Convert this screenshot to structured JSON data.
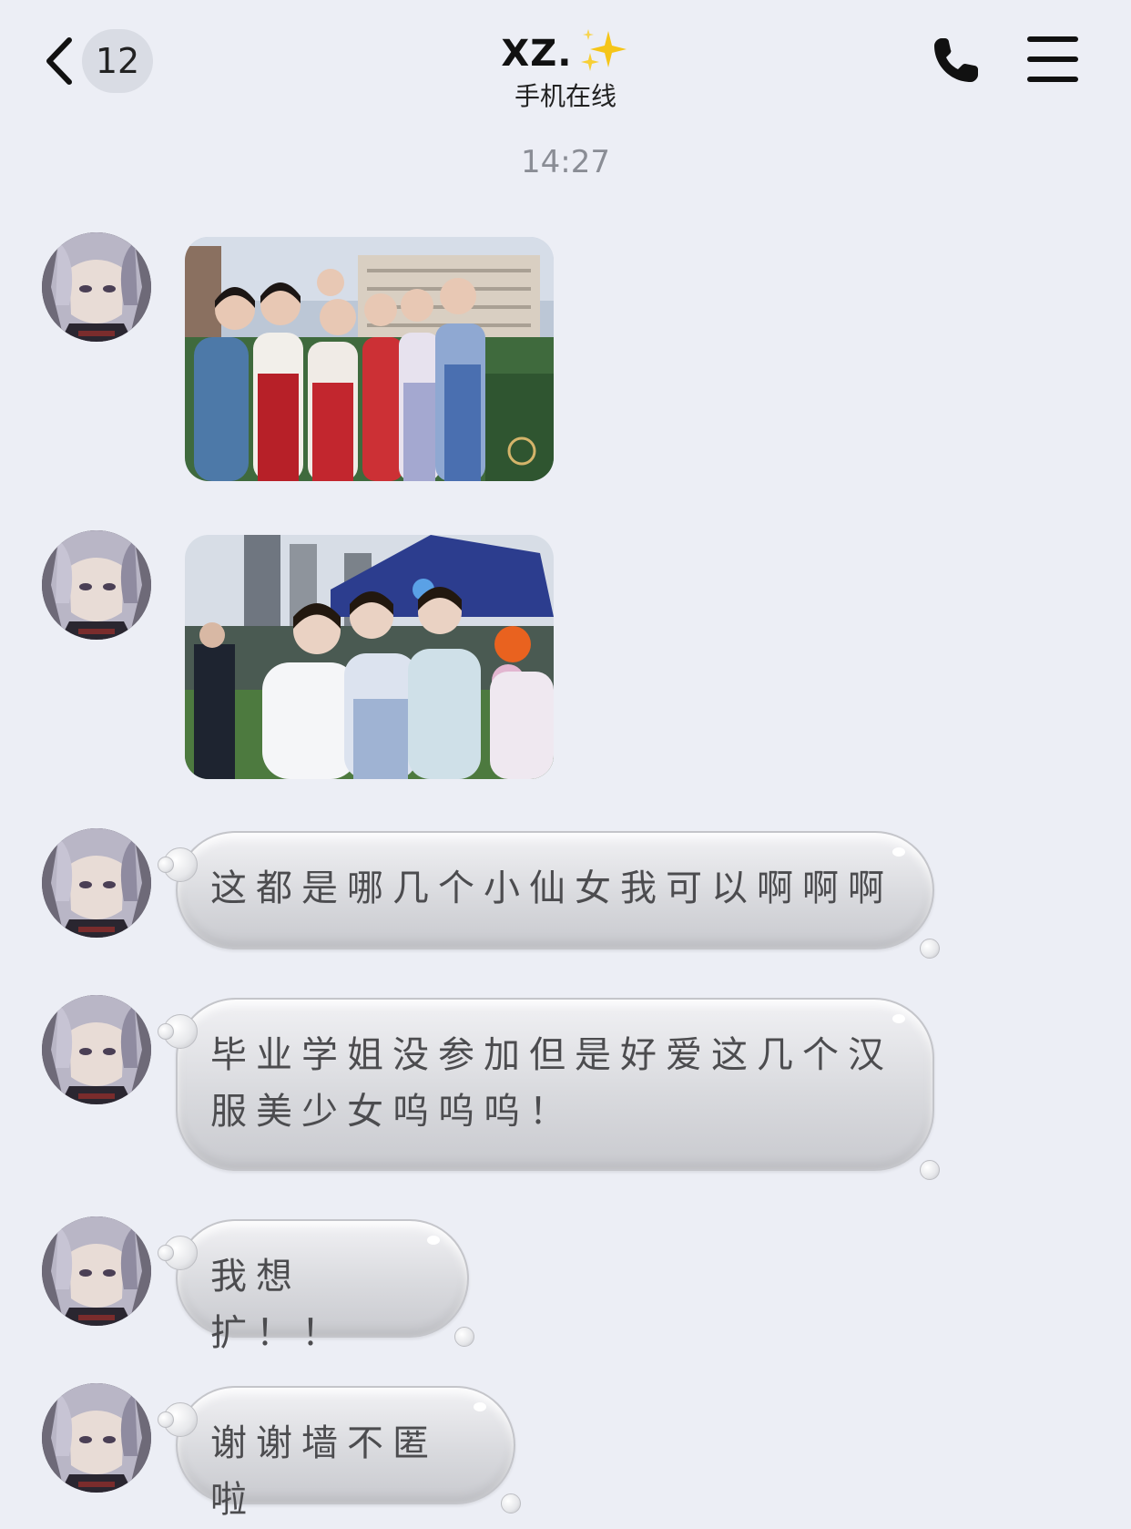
{
  "header": {
    "unread_count": "12",
    "chat_title": "XZ.",
    "status": "手机在线"
  },
  "timestamp": "14:27",
  "messages": [
    {
      "type": "image",
      "icon": "photo-group-hanfu"
    },
    {
      "type": "image",
      "icon": "photo-three-girls"
    },
    {
      "type": "text",
      "text": "这都是哪几个小仙女我可以啊啊啊"
    },
    {
      "type": "text",
      "line1": "毕业学姐没参加但是好爱这几个汉",
      "line2": "服美少女呜呜呜！"
    },
    {
      "type": "text",
      "text": "我想扩！！"
    },
    {
      "type": "text",
      "text": "谢谢墙不匿啦"
    }
  ],
  "colors": {
    "background": "#eceef5",
    "badge": "#d9dce4",
    "timestamp": "#8a8d95",
    "sparkle": "#f5c518"
  }
}
